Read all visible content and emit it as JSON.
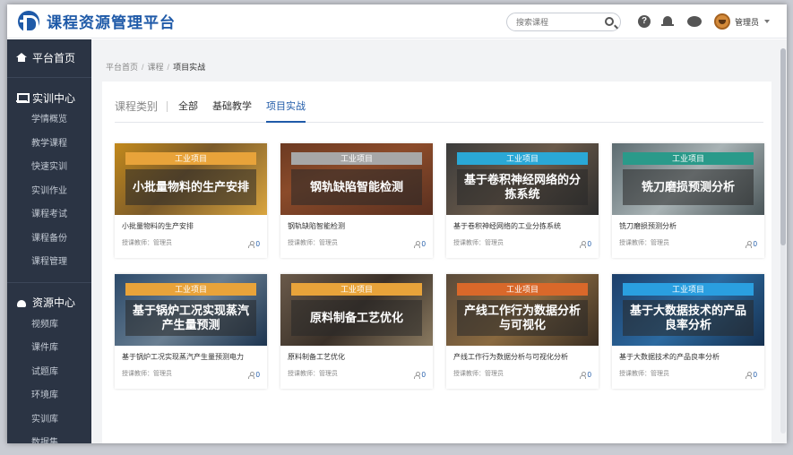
{
  "header": {
    "app_title": "课程资源管理平台",
    "search_placeholder": "搜索课程",
    "help_glyph": "?",
    "user_name": "管理员"
  },
  "sidebar": {
    "home": "平台首页",
    "training": {
      "title": "实训中心",
      "items": [
        "学情概览",
        "教学课程",
        "快速实训",
        "实训作业",
        "课程考试",
        "课程备份",
        "课程管理"
      ]
    },
    "resources": {
      "title": "资源中心",
      "items": [
        "视频库",
        "课件库",
        "试题库",
        "环境库",
        "实训库",
        "数据集"
      ]
    }
  },
  "breadcrumb": [
    "平台首页",
    "课程",
    "项目实战"
  ],
  "breadcrumb_sep": "/",
  "tabs": {
    "category_label": "课程类别",
    "items": [
      "全部",
      "基础教学",
      "项目实战"
    ],
    "active": "项目实战"
  },
  "courses": [
    {
      "tag": "工业项目",
      "thumb_title": "小批量物料的生产安排",
      "title": "小批量物料的生产安排",
      "teacher": "授课教师：管理员",
      "count": "0",
      "ribbon_color": "#e8a33a",
      "bg": "linear-gradient(135deg,#c2891c,#7a5a2a 45%,#d9a53f)"
    },
    {
      "tag": "工业项目",
      "thumb_title": "钢轨缺陷智能检测",
      "title": "钢轨缺陷智能检测",
      "teacher": "授课教师：管理员",
      "count": "0",
      "ribbon_color": "#a7a7a7",
      "bg": "linear-gradient(160deg,#6c3a22,#8b4b2a 40%,#5a3020)"
    },
    {
      "tag": "工业项目",
      "thumb_title": "基于卷积神经网络的分拣系统",
      "title": "基于卷积神经网络的工业分拣系统",
      "teacher": "授课教师：管理员",
      "count": "0",
      "ribbon_color": "#2aa8d6",
      "bg": "linear-gradient(135deg,#3b3b3b,#6a5a4a 50%,#2d2d2d)"
    },
    {
      "tag": "工业项目",
      "thumb_title": "铣刀磨损预测分析",
      "title": "铣刀磨损预测分析",
      "teacher": "授课教师：管理员",
      "count": "0",
      "ribbon_color": "#2a9a8a",
      "bg": "linear-gradient(135deg,#5c6b70,#a9b3b5 50%,#4a5558)"
    },
    {
      "tag": "工业项目",
      "thumb_title": "基于锅炉工况实现蒸汽产生量预测",
      "title": "基于锅炉工况实现蒸汽产生量预测电力",
      "teacher": "授课教师：管理员",
      "count": "0",
      "ribbon_color": "#e8a33a",
      "bg": "linear-gradient(135deg,#2c4a6a,#6a7f92 50%,#1d3550)"
    },
    {
      "tag": "工业项目",
      "thumb_title": "原料制备工艺优化",
      "title": "原料制备工艺优化",
      "teacher": "授课教师：管理员",
      "count": "0",
      "ribbon_color": "#e8a33a",
      "bg": "linear-gradient(135deg,#6a5a4a,#3a3028 50%,#8a7a60)"
    },
    {
      "tag": "工业项目",
      "thumb_title": "产线工作行为数据分析与可视化",
      "title": "产线工作行为数据分析与可视化分析",
      "teacher": "授课教师：管理员",
      "count": "0",
      "ribbon_color": "#d9682a",
      "bg": "linear-gradient(135deg,#5a4a3a,#8a6a40 50%,#3a2e22)"
    },
    {
      "tag": "工业项目",
      "thumb_title": "基于大数据技术的产品良率分析",
      "title": "基于大数据技术的产品良率分析",
      "teacher": "授课教师：管理员",
      "count": "0",
      "ribbon_color": "#2a9fe0",
      "bg": "linear-gradient(135deg,#1d3f6a,#2c6aa0 50%,#16304f)"
    }
  ]
}
